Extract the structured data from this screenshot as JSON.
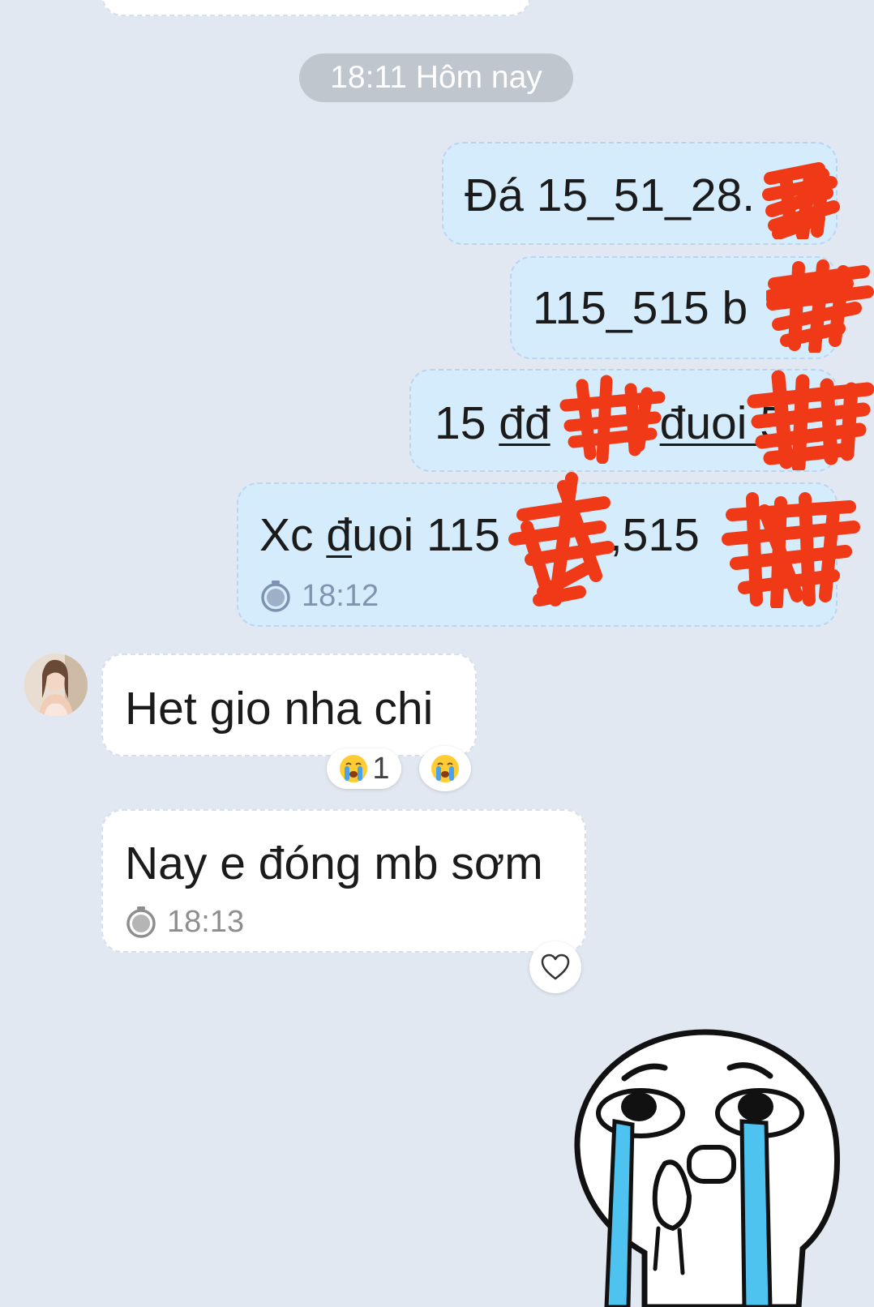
{
  "date_divider": "18:11 Hôm nay",
  "outgoing": {
    "msg1": "Đá 15_51_28.",
    "msg2": "115_515 b",
    "msg3": {
      "a": "15 ",
      "b": "đđ",
      "c": "đuoi 5"
    },
    "msg4": {
      "a": "Xc ",
      "b": "đ",
      "c": "uoi 115",
      "d": ",515"
    },
    "time": "18:12"
  },
  "incoming": {
    "msg1": "Het gio nha chi",
    "reaction_count": "1",
    "msg2": "Nay e đóng mb sơm",
    "time": "18:13"
  },
  "colors": {
    "background": "#e2e8f1",
    "outgoing_bubble": "#d5ecfd",
    "incoming_bubble": "#ffffff",
    "redaction": "#f03a17"
  },
  "icons": [
    "clock-icon",
    "crying-emoji-icon",
    "heart-icon",
    "crying-sticker"
  ]
}
